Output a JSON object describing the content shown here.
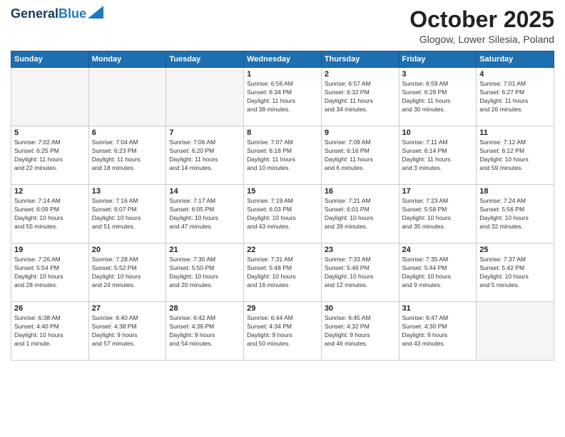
{
  "logo": {
    "line1": "General",
    "line2": "Blue"
  },
  "title": "October 2025",
  "subtitle": "Glogow, Lower Silesia, Poland",
  "days_header": [
    "Sunday",
    "Monday",
    "Tuesday",
    "Wednesday",
    "Thursday",
    "Friday",
    "Saturday"
  ],
  "weeks": [
    [
      {
        "day": "",
        "info": ""
      },
      {
        "day": "",
        "info": ""
      },
      {
        "day": "",
        "info": ""
      },
      {
        "day": "1",
        "info": "Sunrise: 6:56 AM\nSunset: 6:34 PM\nDaylight: 11 hours\nand 38 minutes."
      },
      {
        "day": "2",
        "info": "Sunrise: 6:57 AM\nSunset: 6:32 PM\nDaylight: 11 hours\nand 34 minutes."
      },
      {
        "day": "3",
        "info": "Sunrise: 6:59 AM\nSunset: 6:29 PM\nDaylight: 11 hours\nand 30 minutes."
      },
      {
        "day": "4",
        "info": "Sunrise: 7:01 AM\nSunset: 6:27 PM\nDaylight: 11 hours\nand 26 minutes."
      }
    ],
    [
      {
        "day": "5",
        "info": "Sunrise: 7:02 AM\nSunset: 6:25 PM\nDaylight: 11 hours\nand 22 minutes."
      },
      {
        "day": "6",
        "info": "Sunrise: 7:04 AM\nSunset: 6:23 PM\nDaylight: 11 hours\nand 18 minutes."
      },
      {
        "day": "7",
        "info": "Sunrise: 7:06 AM\nSunset: 6:20 PM\nDaylight: 11 hours\nand 14 minutes."
      },
      {
        "day": "8",
        "info": "Sunrise: 7:07 AM\nSunset: 6:18 PM\nDaylight: 11 hours\nand 10 minutes."
      },
      {
        "day": "9",
        "info": "Sunrise: 7:09 AM\nSunset: 6:16 PM\nDaylight: 11 hours\nand 6 minutes."
      },
      {
        "day": "10",
        "info": "Sunrise: 7:11 AM\nSunset: 6:14 PM\nDaylight: 11 hours\nand 3 minutes."
      },
      {
        "day": "11",
        "info": "Sunrise: 7:12 AM\nSunset: 6:12 PM\nDaylight: 10 hours\nand 59 minutes."
      }
    ],
    [
      {
        "day": "12",
        "info": "Sunrise: 7:14 AM\nSunset: 6:09 PM\nDaylight: 10 hours\nand 55 minutes."
      },
      {
        "day": "13",
        "info": "Sunrise: 7:16 AM\nSunset: 6:07 PM\nDaylight: 10 hours\nand 51 minutes."
      },
      {
        "day": "14",
        "info": "Sunrise: 7:17 AM\nSunset: 6:05 PM\nDaylight: 10 hours\nand 47 minutes."
      },
      {
        "day": "15",
        "info": "Sunrise: 7:19 AM\nSunset: 6:03 PM\nDaylight: 10 hours\nand 43 minutes."
      },
      {
        "day": "16",
        "info": "Sunrise: 7:21 AM\nSunset: 6:01 PM\nDaylight: 10 hours\nand 39 minutes."
      },
      {
        "day": "17",
        "info": "Sunrise: 7:23 AM\nSunset: 5:58 PM\nDaylight: 10 hours\nand 35 minutes."
      },
      {
        "day": "18",
        "info": "Sunrise: 7:24 AM\nSunset: 5:56 PM\nDaylight: 10 hours\nand 32 minutes."
      }
    ],
    [
      {
        "day": "19",
        "info": "Sunrise: 7:26 AM\nSunset: 5:54 PM\nDaylight: 10 hours\nand 28 minutes."
      },
      {
        "day": "20",
        "info": "Sunrise: 7:28 AM\nSunset: 5:52 PM\nDaylight: 10 hours\nand 24 minutes."
      },
      {
        "day": "21",
        "info": "Sunrise: 7:30 AM\nSunset: 5:50 PM\nDaylight: 10 hours\nand 20 minutes."
      },
      {
        "day": "22",
        "info": "Sunrise: 7:31 AM\nSunset: 5:48 PM\nDaylight: 10 hours\nand 16 minutes."
      },
      {
        "day": "23",
        "info": "Sunrise: 7:33 AM\nSunset: 5:46 PM\nDaylight: 10 hours\nand 12 minutes."
      },
      {
        "day": "24",
        "info": "Sunrise: 7:35 AM\nSunset: 5:44 PM\nDaylight: 10 hours\nand 9 minutes."
      },
      {
        "day": "25",
        "info": "Sunrise: 7:37 AM\nSunset: 5:42 PM\nDaylight: 10 hours\nand 5 minutes."
      }
    ],
    [
      {
        "day": "26",
        "info": "Sunrise: 6:38 AM\nSunset: 4:40 PM\nDaylight: 10 hours\nand 1 minute."
      },
      {
        "day": "27",
        "info": "Sunrise: 6:40 AM\nSunset: 4:38 PM\nDaylight: 9 hours\nand 57 minutes."
      },
      {
        "day": "28",
        "info": "Sunrise: 6:42 AM\nSunset: 4:36 PM\nDaylight: 9 hours\nand 54 minutes."
      },
      {
        "day": "29",
        "info": "Sunrise: 6:44 AM\nSunset: 4:34 PM\nDaylight: 9 hours\nand 50 minutes."
      },
      {
        "day": "30",
        "info": "Sunrise: 6:45 AM\nSunset: 4:32 PM\nDaylight: 9 hours\nand 46 minutes."
      },
      {
        "day": "31",
        "info": "Sunrise: 6:47 AM\nSunset: 4:30 PM\nDaylight: 9 hours\nand 43 minutes."
      },
      {
        "day": "",
        "info": ""
      }
    ]
  ]
}
